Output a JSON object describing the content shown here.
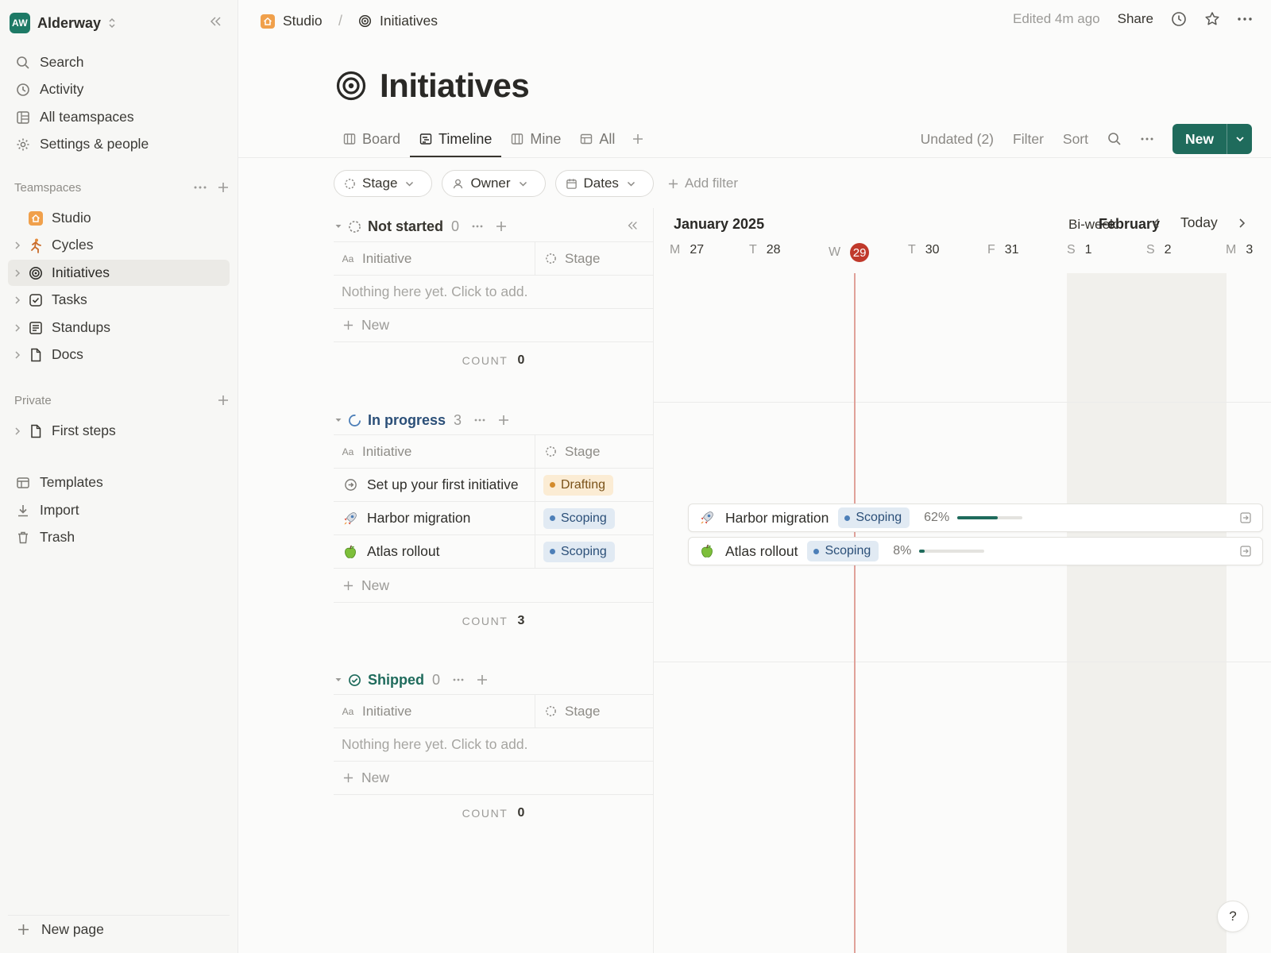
{
  "workspace": {
    "initials": "AW",
    "name": "Alderway"
  },
  "sidebar": {
    "top_items": [
      {
        "label": "Search",
        "icon": "search-icon"
      },
      {
        "label": "Activity",
        "icon": "clock-icon"
      },
      {
        "label": "All teamspaces",
        "icon": "teamspaces-icon"
      },
      {
        "label": "Settings & people",
        "icon": "gear-icon"
      }
    ],
    "teamspaces_label": "Teamspaces",
    "teamspace_items": [
      {
        "label": "Studio",
        "icon": "studio-home-icon"
      },
      {
        "label": "Cycles",
        "icon": "runner-icon"
      },
      {
        "label": "Initiatives",
        "icon": "target-icon"
      },
      {
        "label": "Tasks",
        "icon": "checkbox-icon"
      },
      {
        "label": "Standups",
        "icon": "document-list-icon"
      },
      {
        "label": "Docs",
        "icon": "page-icon"
      }
    ],
    "private_label": "Private",
    "private_items": [
      {
        "label": "First steps",
        "icon": "page-icon"
      }
    ],
    "bottom_items": [
      {
        "label": "Templates",
        "icon": "templates-icon"
      },
      {
        "label": "Import",
        "icon": "import-icon"
      },
      {
        "label": "Trash",
        "icon": "trash-icon"
      }
    ],
    "new_page_label": "New page"
  },
  "breadcrumb": {
    "parent": "Studio",
    "separator": "/",
    "current": "Initiatives"
  },
  "topbar": {
    "edited": "Edited 4m ago",
    "share": "Share"
  },
  "page": {
    "title": "Initiatives"
  },
  "views": {
    "tabs": [
      {
        "label": "Board",
        "icon": "board-icon"
      },
      {
        "label": "Timeline",
        "icon": "timeline-icon"
      },
      {
        "label": "Mine",
        "icon": "board-icon"
      },
      {
        "label": "All",
        "icon": "table-icon"
      }
    ],
    "active": "Timeline",
    "undated": "Undated (2)",
    "filter": "Filter",
    "sort": "Sort",
    "new_label": "New"
  },
  "filters": {
    "stage": "Stage",
    "owner": "Owner",
    "dates": "Dates",
    "add_filter": "Add filter"
  },
  "table": {
    "col_initiative": "Initiative",
    "col_stage": "Stage",
    "empty_text": "Nothing here yet. Click to add.",
    "new_label": "New",
    "count_label": "COUNT",
    "groups": [
      {
        "name": "Not started",
        "count": "0",
        "color": "#37352f",
        "count_value": "0"
      },
      {
        "name": "In progress",
        "count": "3",
        "color": "#2b4f78",
        "count_value": "3"
      },
      {
        "name": "Shipped",
        "count": "0",
        "color": "#1f6b5c",
        "count_value": "0"
      }
    ],
    "rows": [
      {
        "name": "Set up your first initiative",
        "icon": "arrow-circle-icon",
        "stage": "Drafting"
      },
      {
        "name": "Harbor migration",
        "icon": "rocket-emoji",
        "stage": "Scoping"
      },
      {
        "name": "Atlas rollout",
        "icon": "green-apple-emoji",
        "stage": "Scoping"
      }
    ]
  },
  "timeline": {
    "month": "January 2025",
    "next_month": "February",
    "range_label": "Bi-week",
    "today_label": "Today",
    "days": [
      {
        "letter": "M",
        "num": "27"
      },
      {
        "letter": "T",
        "num": "28"
      },
      {
        "letter": "W",
        "num": "29",
        "today": true
      },
      {
        "letter": "T",
        "num": "30"
      },
      {
        "letter": "F",
        "num": "31"
      },
      {
        "letter": "S",
        "num": "1"
      },
      {
        "letter": "S",
        "num": "2"
      },
      {
        "letter": "M",
        "num": "3"
      }
    ],
    "bars": [
      {
        "name": "Harbor migration",
        "stage": "Scoping",
        "percent_label": "62%",
        "progress": 0.62
      },
      {
        "name": "Atlas rollout",
        "stage": "Scoping",
        "percent_label": "8%",
        "progress": 0.08
      }
    ]
  },
  "help": "?",
  "colors": {
    "accent": "#1f6b5c",
    "today": "#c0392b",
    "drafting": "#d38b2c",
    "scoping": "#4d7fb8"
  }
}
